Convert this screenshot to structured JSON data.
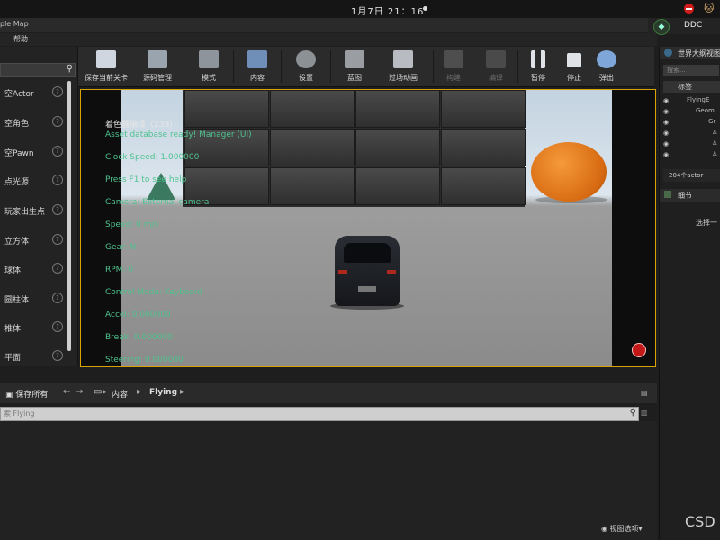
{
  "system": {
    "clock": "1月7日  21：16"
  },
  "window": {
    "tab_label": "ple Map",
    "ddc_label": "DDC"
  },
  "menu": {
    "help": "帮助"
  },
  "place_actors": {
    "items": [
      {
        "label": "空Actor"
      },
      {
        "label": "空角色"
      },
      {
        "label": "空Pawn"
      },
      {
        "label": "点光源"
      },
      {
        "label": "玩家出生点"
      },
      {
        "label": "立方体"
      },
      {
        "label": "球体"
      },
      {
        "label": "圆柱体"
      },
      {
        "label": "椎体"
      },
      {
        "label": "平面"
      }
    ]
  },
  "toolbar": {
    "buttons": [
      {
        "label": "保存当前关卡"
      },
      {
        "label": "源码管理"
      },
      {
        "label": "模式"
      },
      {
        "label": "内容"
      },
      {
        "label": "设置"
      },
      {
        "label": "蓝图"
      },
      {
        "label": "过场动画"
      },
      {
        "label": "构建"
      },
      {
        "label": "编译"
      },
      {
        "label": "暂停"
      },
      {
        "label": "停止"
      },
      {
        "label": "弹出"
      }
    ]
  },
  "hud": {
    "lines": [
      "着色器编译（239）",
      "Asset database ready! Manager (UI)",
      "Clock Speed: 1.000000",
      "Press F1 to see help",
      "Camera: External camera",
      "Speed: 0 m/s",
      "Gear: N",
      "RPM: 0",
      "Control Mode: Keyboard",
      "Accel: 0.000000",
      "Break: 0.000000",
      "Steering: 0.000000"
    ]
  },
  "outliner": {
    "title": "世界大纲视图",
    "search_placeholder": "搜索...",
    "column_label": "标签",
    "rows": [
      "FlyingE",
      "Geom",
      "Gr"
    ],
    "count": "204个actor"
  },
  "details": {
    "title": "细节",
    "select_hint": "选择一"
  },
  "content_browser": {
    "save_all": "保存所有",
    "crumb_content": "内容",
    "crumb_folder": "Flying",
    "search_placeholder": "索 Flying",
    "view_options": "视图选项"
  },
  "watermark": "CSD"
}
